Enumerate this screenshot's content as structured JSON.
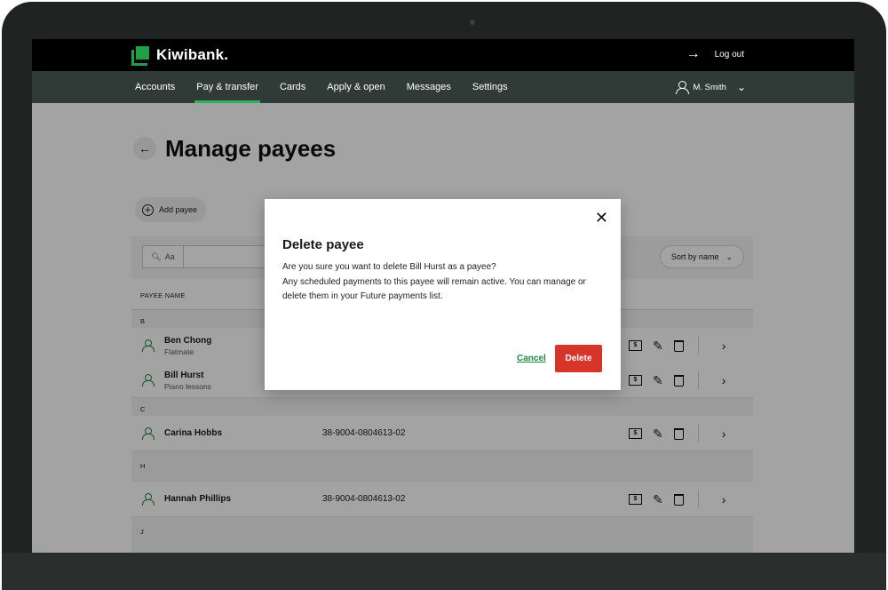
{
  "brand": {
    "name": "Kiwibank.",
    "color": "#1fa046"
  },
  "topbar": {
    "logout_label": "Log out"
  },
  "nav": {
    "items": [
      {
        "label": "Accounts"
      },
      {
        "label": "Pay & transfer"
      },
      {
        "label": "Cards"
      },
      {
        "label": "Apply & open"
      },
      {
        "label": "Messages"
      },
      {
        "label": "Settings"
      }
    ],
    "active_index": 1,
    "user_name": "M. Smith"
  },
  "page": {
    "title": "Manage payees",
    "add_payee_label": "Add payee"
  },
  "filter": {
    "search_placeholder": "Aa",
    "sort_label": "Sort by name"
  },
  "list": {
    "column_header": "PAYEE NAME",
    "groups": [
      {
        "letter": "B",
        "payees": [
          {
            "name": "Ben Chong",
            "note": "Flatmate"
          },
          {
            "name": "Bill Hurst",
            "note": "Piano lessons"
          }
        ]
      },
      {
        "letter": "C",
        "payees": [
          {
            "name": "Carina Hobbs",
            "account": "38-9004-0804613-02"
          }
        ]
      },
      {
        "letter": "H",
        "payees": [
          {
            "name": "Hannah Phillips",
            "account": "38-9004-0804613-02"
          }
        ]
      },
      {
        "letter": "J",
        "payees": []
      }
    ]
  },
  "modal": {
    "title": "Delete payee",
    "line1": "Are you sure you want to delete Bill Hurst as a payee?",
    "line2": "Any scheduled payments to this payee will remain active. You can manage or delete them in your Future payments list.",
    "cancel_label": "Cancel",
    "delete_label": "Delete",
    "delete_color": "#d8352a"
  }
}
